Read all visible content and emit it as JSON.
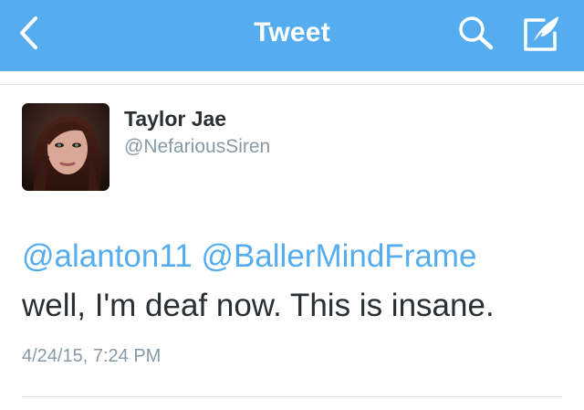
{
  "header": {
    "title": "Tweet",
    "back_icon": "chevron-left-icon",
    "search_icon": "search-icon",
    "compose_icon": "compose-tweet-icon",
    "background_color": "#55acee"
  },
  "tweet": {
    "author": {
      "name": "Taylor Jae",
      "handle": "@NefariousSiren"
    },
    "mentions": [
      "@alanton11",
      "@BallerMindFrame"
    ],
    "text": "well, I'm deaf now. This is insane.",
    "timestamp": "4/24/15, 7:24 PM",
    "mention_color": "#55acee"
  }
}
